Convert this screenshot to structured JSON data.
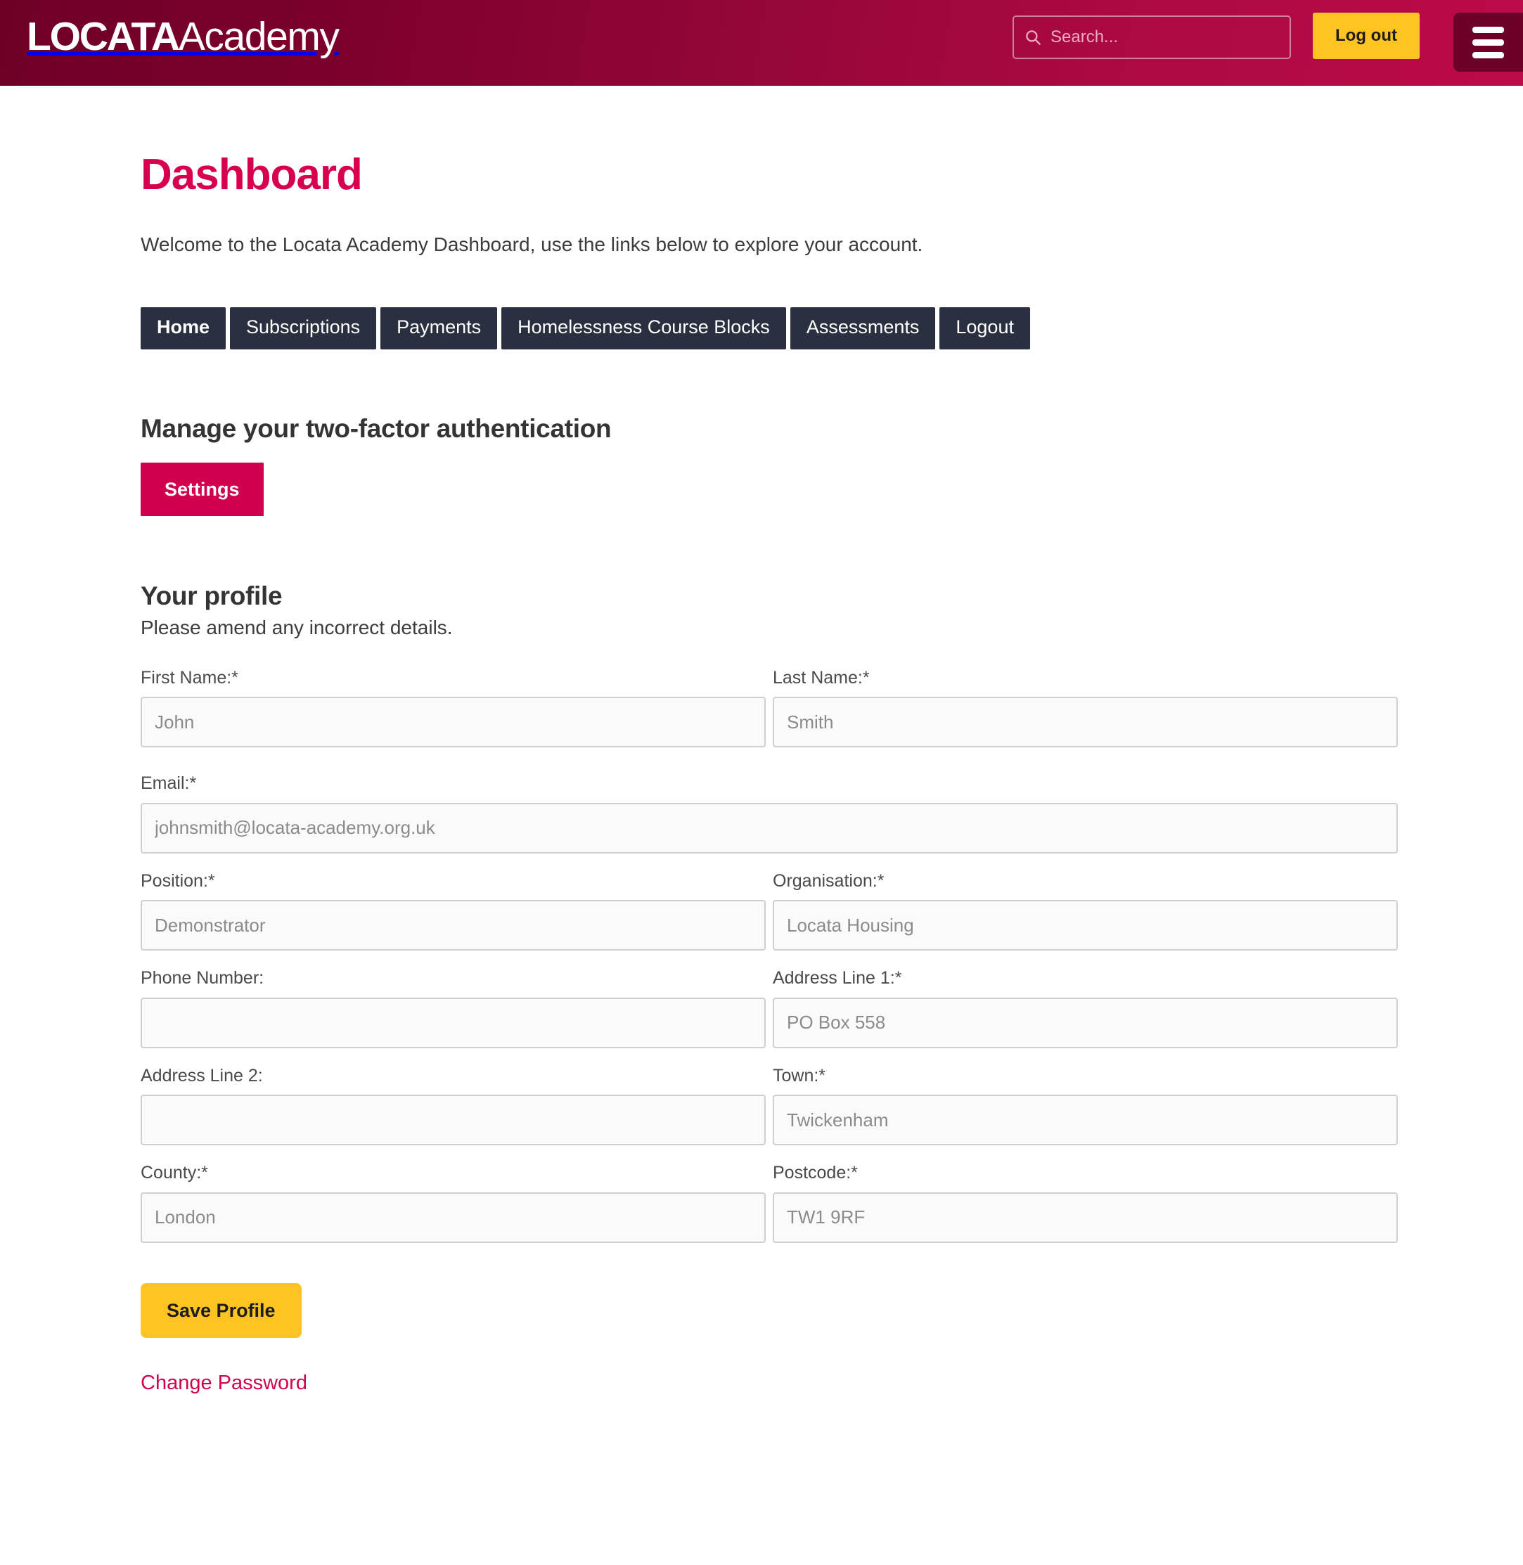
{
  "header": {
    "brand_bold": "LOCATA",
    "brand_light": "Academy",
    "search": {
      "icon": "search-icon",
      "placeholder": "Search...",
      "value": ""
    },
    "logout_label": "Log out",
    "menu_icon": "hamburger-menu-icon",
    "colors": {
      "gradient_start": "#6e0026",
      "gradient_end": "#bb0b48",
      "accent_yellow": "#ffc422",
      "menu_button": "#6d0027"
    }
  },
  "main": {
    "title": "Dashboard",
    "welcome": "Welcome to the Locata Academy Dashboard, use the links below to explore your account.",
    "nav_tabs": [
      {
        "label": "Home",
        "active": true
      },
      {
        "label": "Subscriptions",
        "active": false
      },
      {
        "label": "Payments",
        "active": false
      },
      {
        "label": "Homelessness Course Blocks",
        "active": false
      },
      {
        "label": "Assessments",
        "active": false
      },
      {
        "label": "Logout",
        "active": false
      }
    ],
    "two_factor": {
      "heading": "Manage your two-factor authentication",
      "settings_label": "Settings"
    },
    "profile": {
      "heading": "Your profile",
      "subheading": "Please amend any incorrect details.",
      "fields": [
        {
          "label": "First Name:*",
          "value": "John",
          "placeholder": "John",
          "name": "first-name"
        },
        {
          "label": "Last Name:*",
          "value": "Smith",
          "placeholder": "Smith",
          "name": "last-name"
        },
        {
          "label": "Email:*",
          "value": "johnsmith@locata-academy.org.uk",
          "placeholder": "johnsmith@locata-academy.org.uk",
          "name": "email"
        },
        {
          "label": "Position:*",
          "value": "Demonstrator",
          "placeholder": "Demonstrator",
          "name": "position"
        },
        {
          "label": "Organisation:*",
          "value": "Locata Housing",
          "placeholder": "Locata Housing",
          "name": "organisation"
        },
        {
          "label": "Phone Number:",
          "value": "",
          "placeholder": "",
          "name": "phone-number"
        },
        {
          "label": "Address Line 1:*",
          "value": "PO Box 558",
          "placeholder": "PO Box 558",
          "name": "address-line-1"
        },
        {
          "label": "Address Line 2:",
          "value": "",
          "placeholder": "",
          "name": "address-line-2"
        },
        {
          "label": "Town:*",
          "value": "Twickenham",
          "placeholder": "Twickenham",
          "name": "town"
        },
        {
          "label": "County:*",
          "value": "London",
          "placeholder": "London",
          "name": "county"
        },
        {
          "label": "Postcode:*",
          "value": "TW1 9RF",
          "placeholder": "TW1 9RF",
          "name": "postcode"
        }
      ],
      "save_label": "Save Profile",
      "change_password_label": "Change Password"
    },
    "colors": {
      "title_pink": "#d6004f",
      "nav_tab_bg": "#2b3040",
      "settings_pink": "#d1004e",
      "save_yellow": "#ffc422"
    }
  }
}
